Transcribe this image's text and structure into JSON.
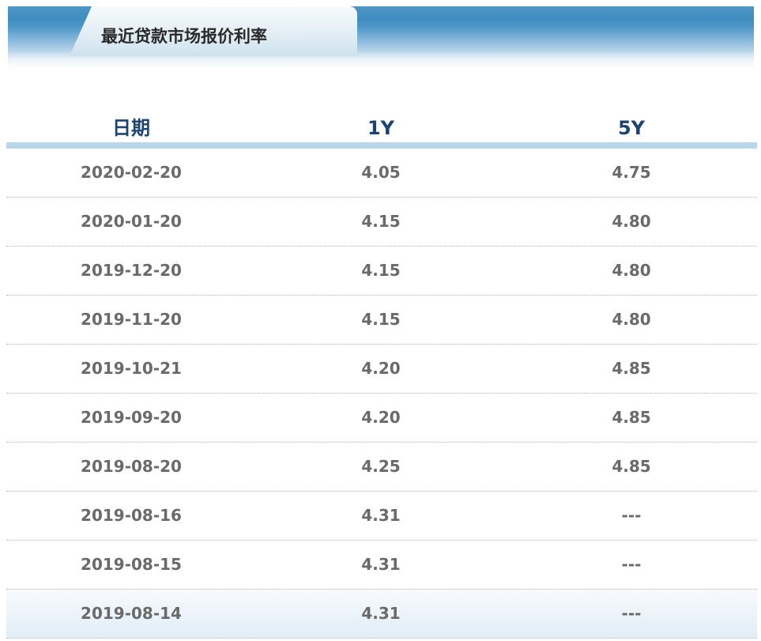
{
  "header": {
    "title": "最近贷款市场报价利率"
  },
  "table": {
    "columns": [
      "日期",
      "1Y",
      "5Y"
    ],
    "rows": [
      {
        "date": "2020-02-20",
        "y1": "4.05",
        "y5": "4.75"
      },
      {
        "date": "2020-01-20",
        "y1": "4.15",
        "y5": "4.80"
      },
      {
        "date": "2019-12-20",
        "y1": "4.15",
        "y5": "4.80"
      },
      {
        "date": "2019-11-20",
        "y1": "4.15",
        "y5": "4.80"
      },
      {
        "date": "2019-10-21",
        "y1": "4.20",
        "y5": "4.85"
      },
      {
        "date": "2019-09-20",
        "y1": "4.20",
        "y5": "4.85"
      },
      {
        "date": "2019-08-20",
        "y1": "4.25",
        "y5": "4.85"
      },
      {
        "date": "2019-08-16",
        "y1": "4.31",
        "y5": "---"
      },
      {
        "date": "2019-08-15",
        "y1": "4.31",
        "y5": "---"
      },
      {
        "date": "2019-08-14",
        "y1": "4.31",
        "y5": "---"
      }
    ]
  },
  "colors": {
    "header_blue": "#3f8cc0",
    "column_header_text": "#1b4570",
    "header_underline": "#b9d6ea",
    "cell_text": "#6a6a6a",
    "row_highlight": "#e2edf6"
  }
}
